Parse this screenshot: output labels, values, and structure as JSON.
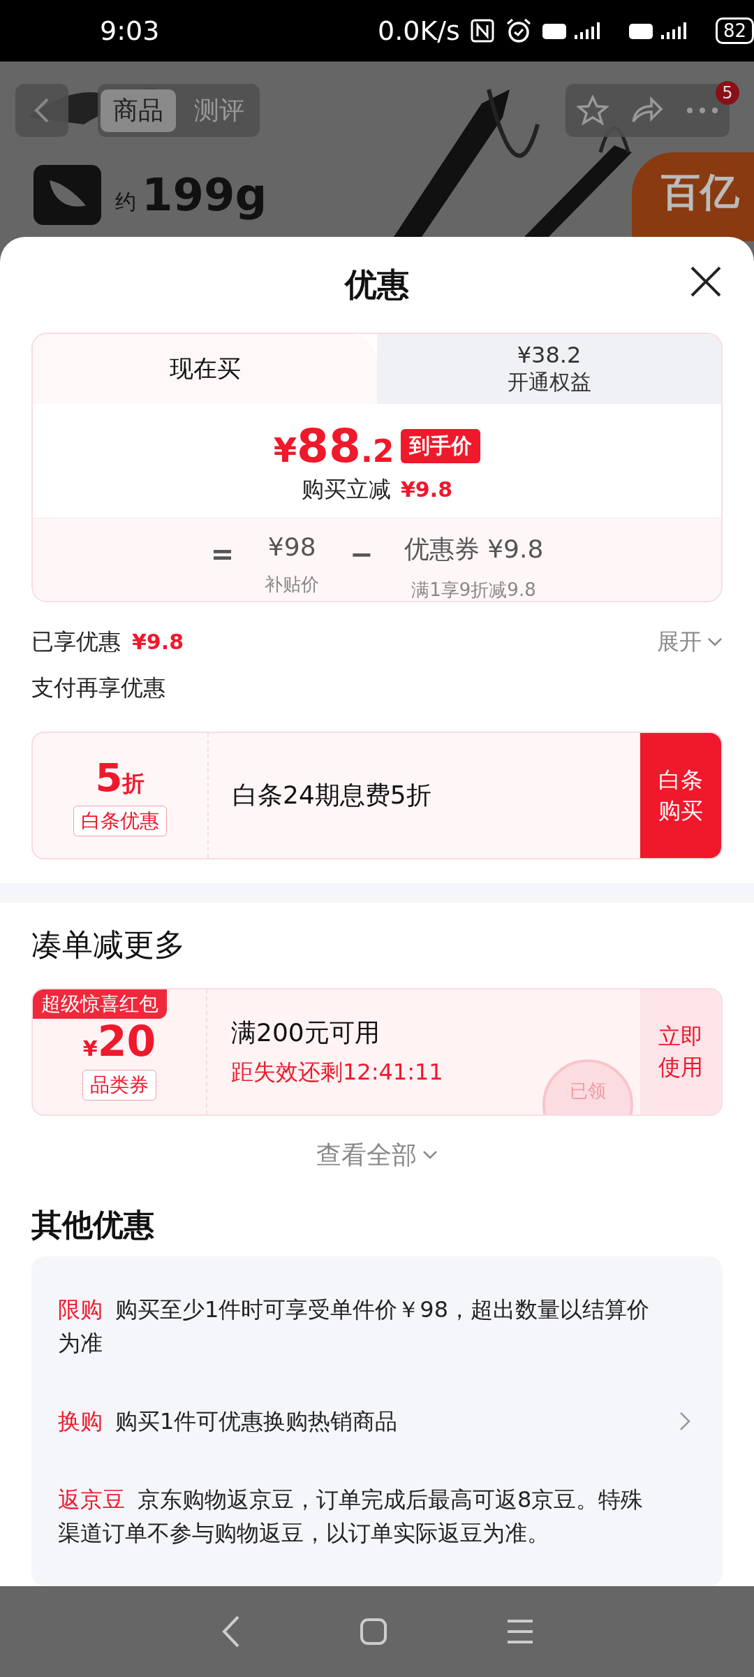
{
  "status_bar": {
    "time": "9:03",
    "net_speed": "0.0K/s",
    "battery": "82"
  },
  "background_page": {
    "tabs": [
      {
        "label": "商品",
        "selected": true
      },
      {
        "label": "测评",
        "selected": false
      }
    ],
    "cart_badge": "5",
    "weight_prefix": "约",
    "weight": "199g",
    "promo_badge": "百亿"
  },
  "sheet": {
    "title": "优惠"
  },
  "price_card": {
    "tabs": [
      {
        "label": "现在买",
        "selected": true
      },
      {
        "price": "¥38.2",
        "label": "开通权益",
        "selected": false
      }
    ],
    "final_price": {
      "symbol": "¥",
      "integer": "88",
      "decimal": ".2"
    },
    "final_price_tag": "到手价",
    "instant_discount_label": "购买立减",
    "instant_discount": "¥9.8",
    "breakdown": [
      {
        "kind": "operator",
        "text": "="
      },
      {
        "kind": "term",
        "amount": "¥98",
        "caption": "补贴价"
      },
      {
        "kind": "operator",
        "text": "−"
      },
      {
        "kind": "term",
        "label": "优惠券",
        "amount": "¥9.8",
        "caption": "满1享9折减9.8"
      }
    ]
  },
  "enjoyed": {
    "label": "已享优惠",
    "amount": "¥9.8",
    "expand": "展开"
  },
  "payment_section": {
    "title": "支付再享优惠",
    "offer": {
      "value": "5",
      "unit": "折",
      "tag": "白条优惠",
      "description": "白条24期息费5折",
      "action": "白条购买"
    }
  },
  "bundle_section": {
    "title": "凑单减更多",
    "coupons": [
      {
        "ribbon": "超级惊喜红包",
        "currency": "¥",
        "amount": "20",
        "type": "品类券",
        "condition": "满200元可用",
        "countdown": "距失效还剩12:41:11",
        "action": "立即使用",
        "claimed": true,
        "stamp": "已领"
      }
    ],
    "view_all": "查看全部"
  },
  "other_section": {
    "title": "其他优惠",
    "items": [
      {
        "label": "限购",
        "text": "购买至少1件时可享受单件价￥98，超出数量以结算价为准",
        "arrow": false
      },
      {
        "label": "换购",
        "text": "购买1件可优惠换购热销商品",
        "arrow": true
      },
      {
        "label": "返京豆",
        "text": "京东购物返京豆，订单完成后最高可返8京豆。特殊渠道订单不参与购物返豆，以订单实际返豆为准。",
        "arrow": false
      }
    ]
  }
}
